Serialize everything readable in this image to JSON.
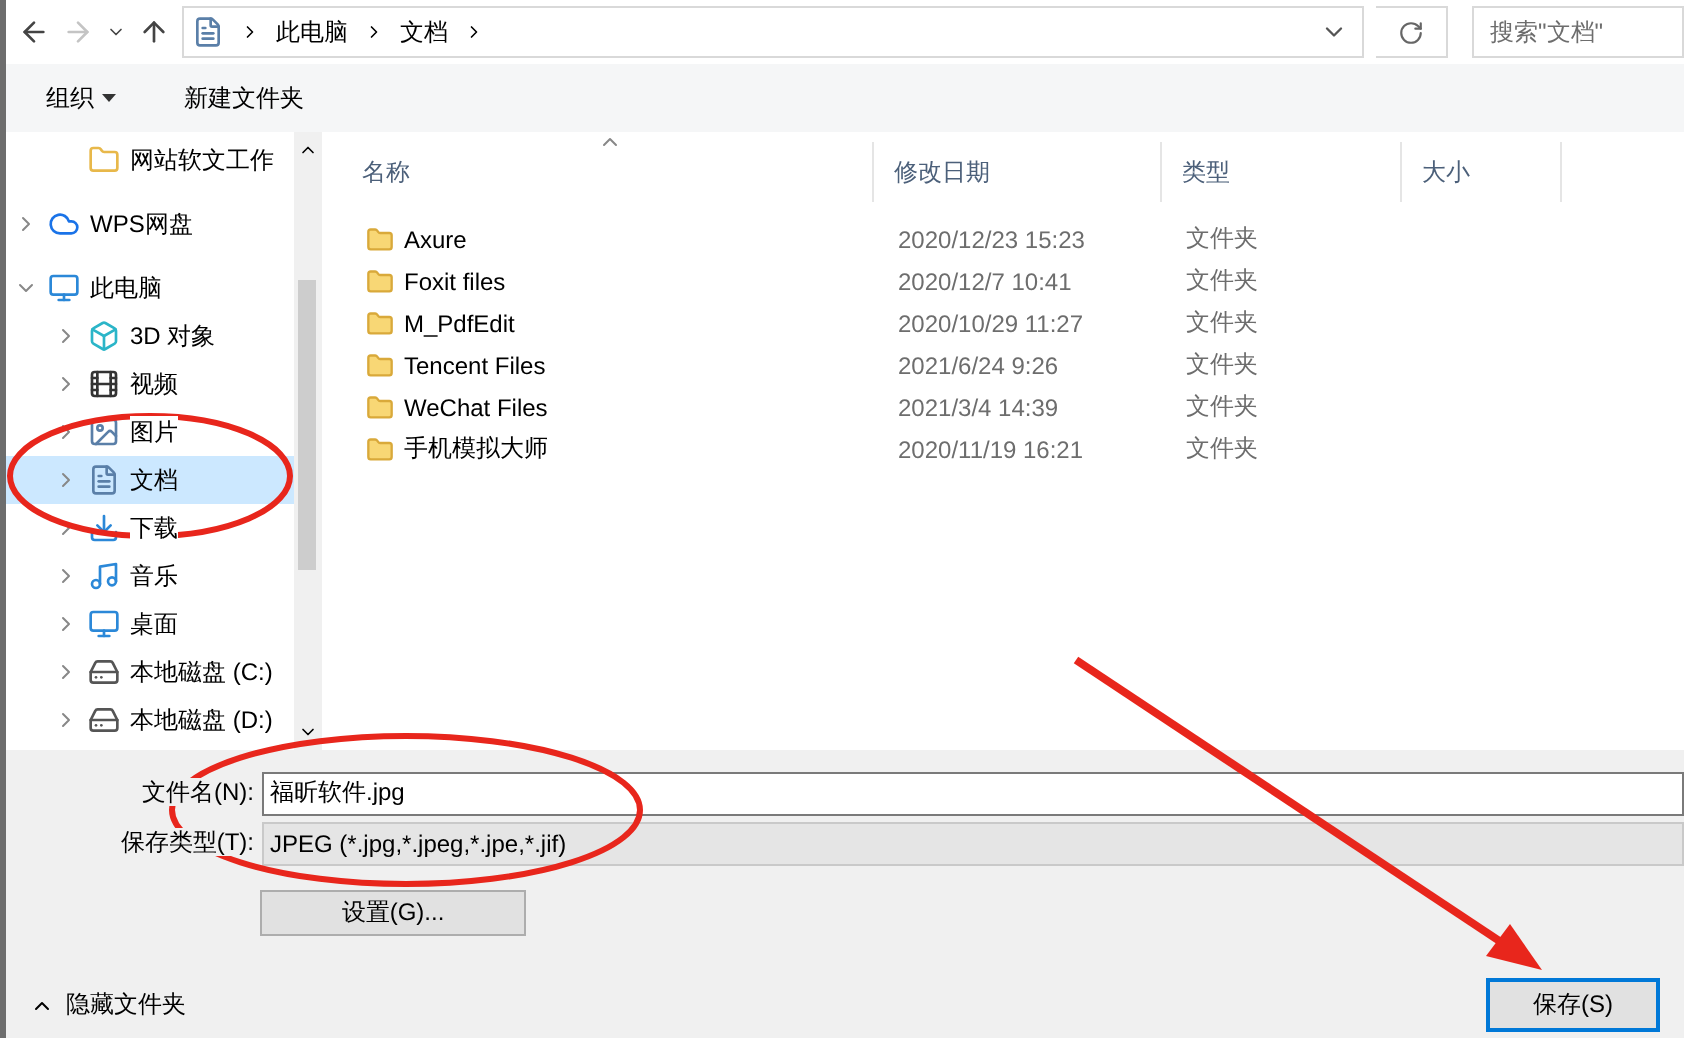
{
  "address_bar": {
    "path": [
      "此电脑",
      "文档"
    ],
    "search_placeholder": "搜索\"文档\""
  },
  "toolbar": {
    "organize": "组织",
    "new_folder": "新建文件夹"
  },
  "sidebar": {
    "items": [
      {
        "label": "网站软文工作",
        "kind": "folder",
        "selected": false
      },
      {
        "label": "WPS网盘",
        "kind": "cloud",
        "expanded": false,
        "selected": false
      },
      {
        "label": "此电脑",
        "kind": "pc",
        "expanded": true,
        "selected": false,
        "children": [
          {
            "label": "3D 对象",
            "kind": "cube",
            "expanded": false,
            "selected": false
          },
          {
            "label": "视频",
            "kind": "video",
            "expanded": false,
            "selected": false
          },
          {
            "label": "图片",
            "kind": "picture",
            "expanded": false,
            "selected": false
          },
          {
            "label": "文档",
            "kind": "document",
            "expanded": false,
            "selected": true
          },
          {
            "label": "下载",
            "kind": "download",
            "expanded": false,
            "selected": false
          },
          {
            "label": "音乐",
            "kind": "music",
            "expanded": false,
            "selected": false
          },
          {
            "label": "桌面",
            "kind": "desktop",
            "expanded": false,
            "selected": false
          },
          {
            "label": "本地磁盘 (C:)",
            "kind": "drive",
            "expanded": false,
            "selected": false
          },
          {
            "label": "本地磁盘 (D:)",
            "kind": "drive",
            "expanded": false,
            "selected": false
          }
        ]
      }
    ]
  },
  "table": {
    "columns": [
      "名称",
      "修改日期",
      "类型",
      "大小"
    ],
    "rows": [
      {
        "name": "Axure",
        "modified": "2020/12/23 15:23",
        "type": "文件夹"
      },
      {
        "name": "Foxit files",
        "modified": "2020/12/7 10:41",
        "type": "文件夹"
      },
      {
        "name": "M_PdfEdit",
        "modified": "2020/10/29 11:27",
        "type": "文件夹"
      },
      {
        "name": "Tencent Files",
        "modified": "2021/6/24 9:26",
        "type": "文件夹"
      },
      {
        "name": "WeChat Files",
        "modified": "2021/3/4 14:39",
        "type": "文件夹"
      },
      {
        "name": "手机模拟大师",
        "modified": "2020/11/19 16:21",
        "type": "文件夹"
      }
    ]
  },
  "form": {
    "filename_label": "文件名(N):",
    "filename": "福昕软件.jpg",
    "type_label": "保存类型(T):",
    "type_value": "JPEG (*.jpg,*.jpeg,*.jpe,*.jif)",
    "settings_button": "设置(G)..."
  },
  "footer": {
    "hide_folders": "隐藏文件夹",
    "save_button": "保存(S)"
  }
}
